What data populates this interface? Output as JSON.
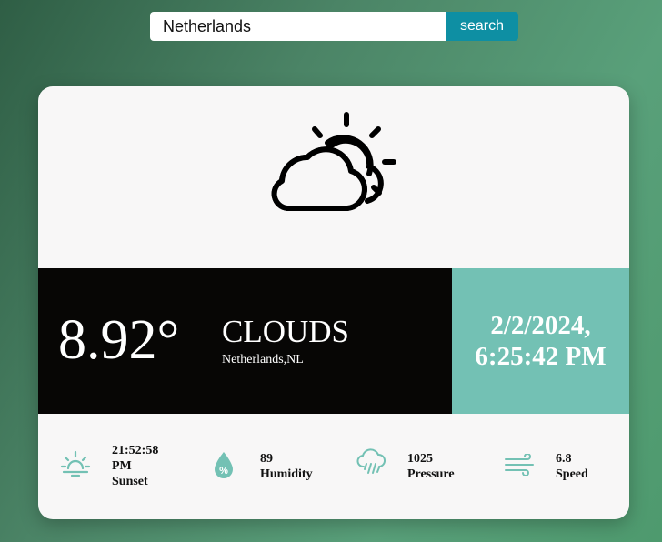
{
  "search": {
    "value": "Netherlands",
    "button_label": "search"
  },
  "weather_icon": "cloud-sun-icon",
  "main": {
    "temperature": "8.92°",
    "condition": "CLOUDS",
    "location": "Netherlands,NL",
    "date": "2/2/2024,",
    "time": "6:25:42 PM"
  },
  "stats": {
    "sunset": {
      "value_line1": "21:52:58",
      "value_line2": "PM",
      "label": "Sunset",
      "icon": "sunset-icon"
    },
    "humidity": {
      "value": "89",
      "label": "Humidity",
      "icon": "humidity-drop-icon"
    },
    "pressure": {
      "value": "1025",
      "label": "Pressure",
      "icon": "rain-cloud-icon"
    },
    "speed": {
      "value": "6.8",
      "label": "Speed",
      "icon": "wind-icon"
    }
  },
  "colors": {
    "accent": "#73c1b4",
    "button": "#0e8fa3",
    "dark_band": "#070605"
  }
}
